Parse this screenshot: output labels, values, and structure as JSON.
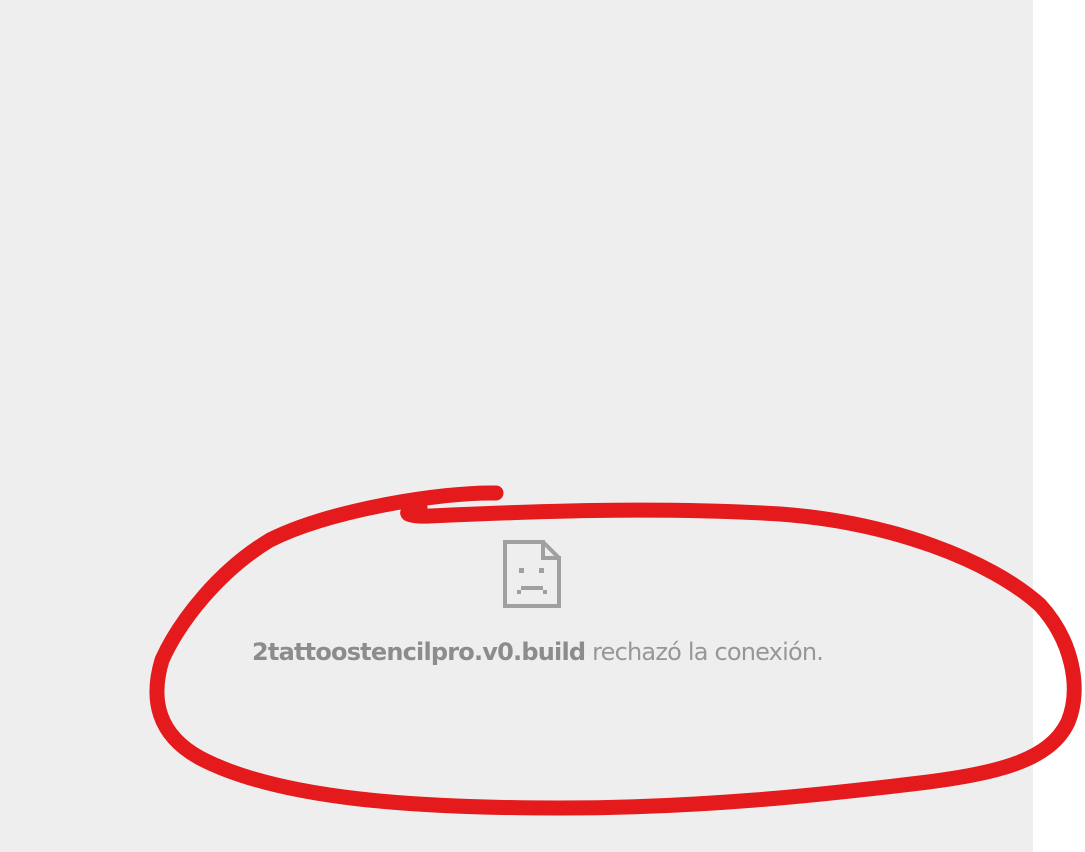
{
  "error": {
    "host": "2tattoostencilpro.v0.build",
    "message": " rechazó la conexión.",
    "icon": "sad-page-icon"
  },
  "colors": {
    "frame_background": "#eeeeee",
    "text": "#979797",
    "icon": "#a0a0a0",
    "annotation": "#e41a1c"
  }
}
